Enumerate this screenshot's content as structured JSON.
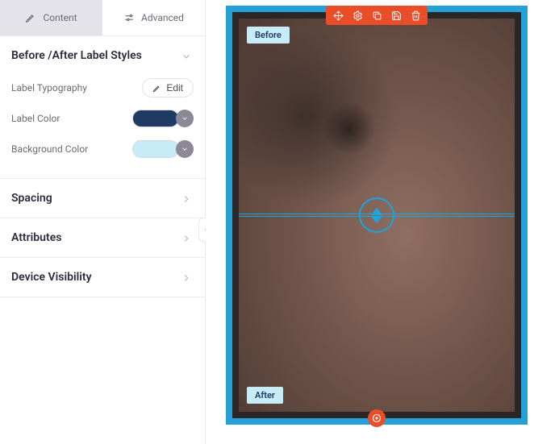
{
  "tabs": {
    "content": "Content",
    "advanced": "Advanced"
  },
  "sections": {
    "labelStyles": {
      "title": "Before /After Label Styles",
      "typography": {
        "label": "Label Typography",
        "button": "Edit"
      },
      "labelColor": {
        "label": "Label Color",
        "value": "#1f3a63"
      },
      "bgColor": {
        "label": "Background Color",
        "value": "#c7ecf8"
      }
    },
    "spacing": {
      "title": "Spacing"
    },
    "attributes": {
      "title": "Attributes"
    },
    "deviceVisibility": {
      "title": "Device Visibility"
    }
  },
  "widget": {
    "beforeLabel": "Before",
    "afterLabel": "After"
  }
}
